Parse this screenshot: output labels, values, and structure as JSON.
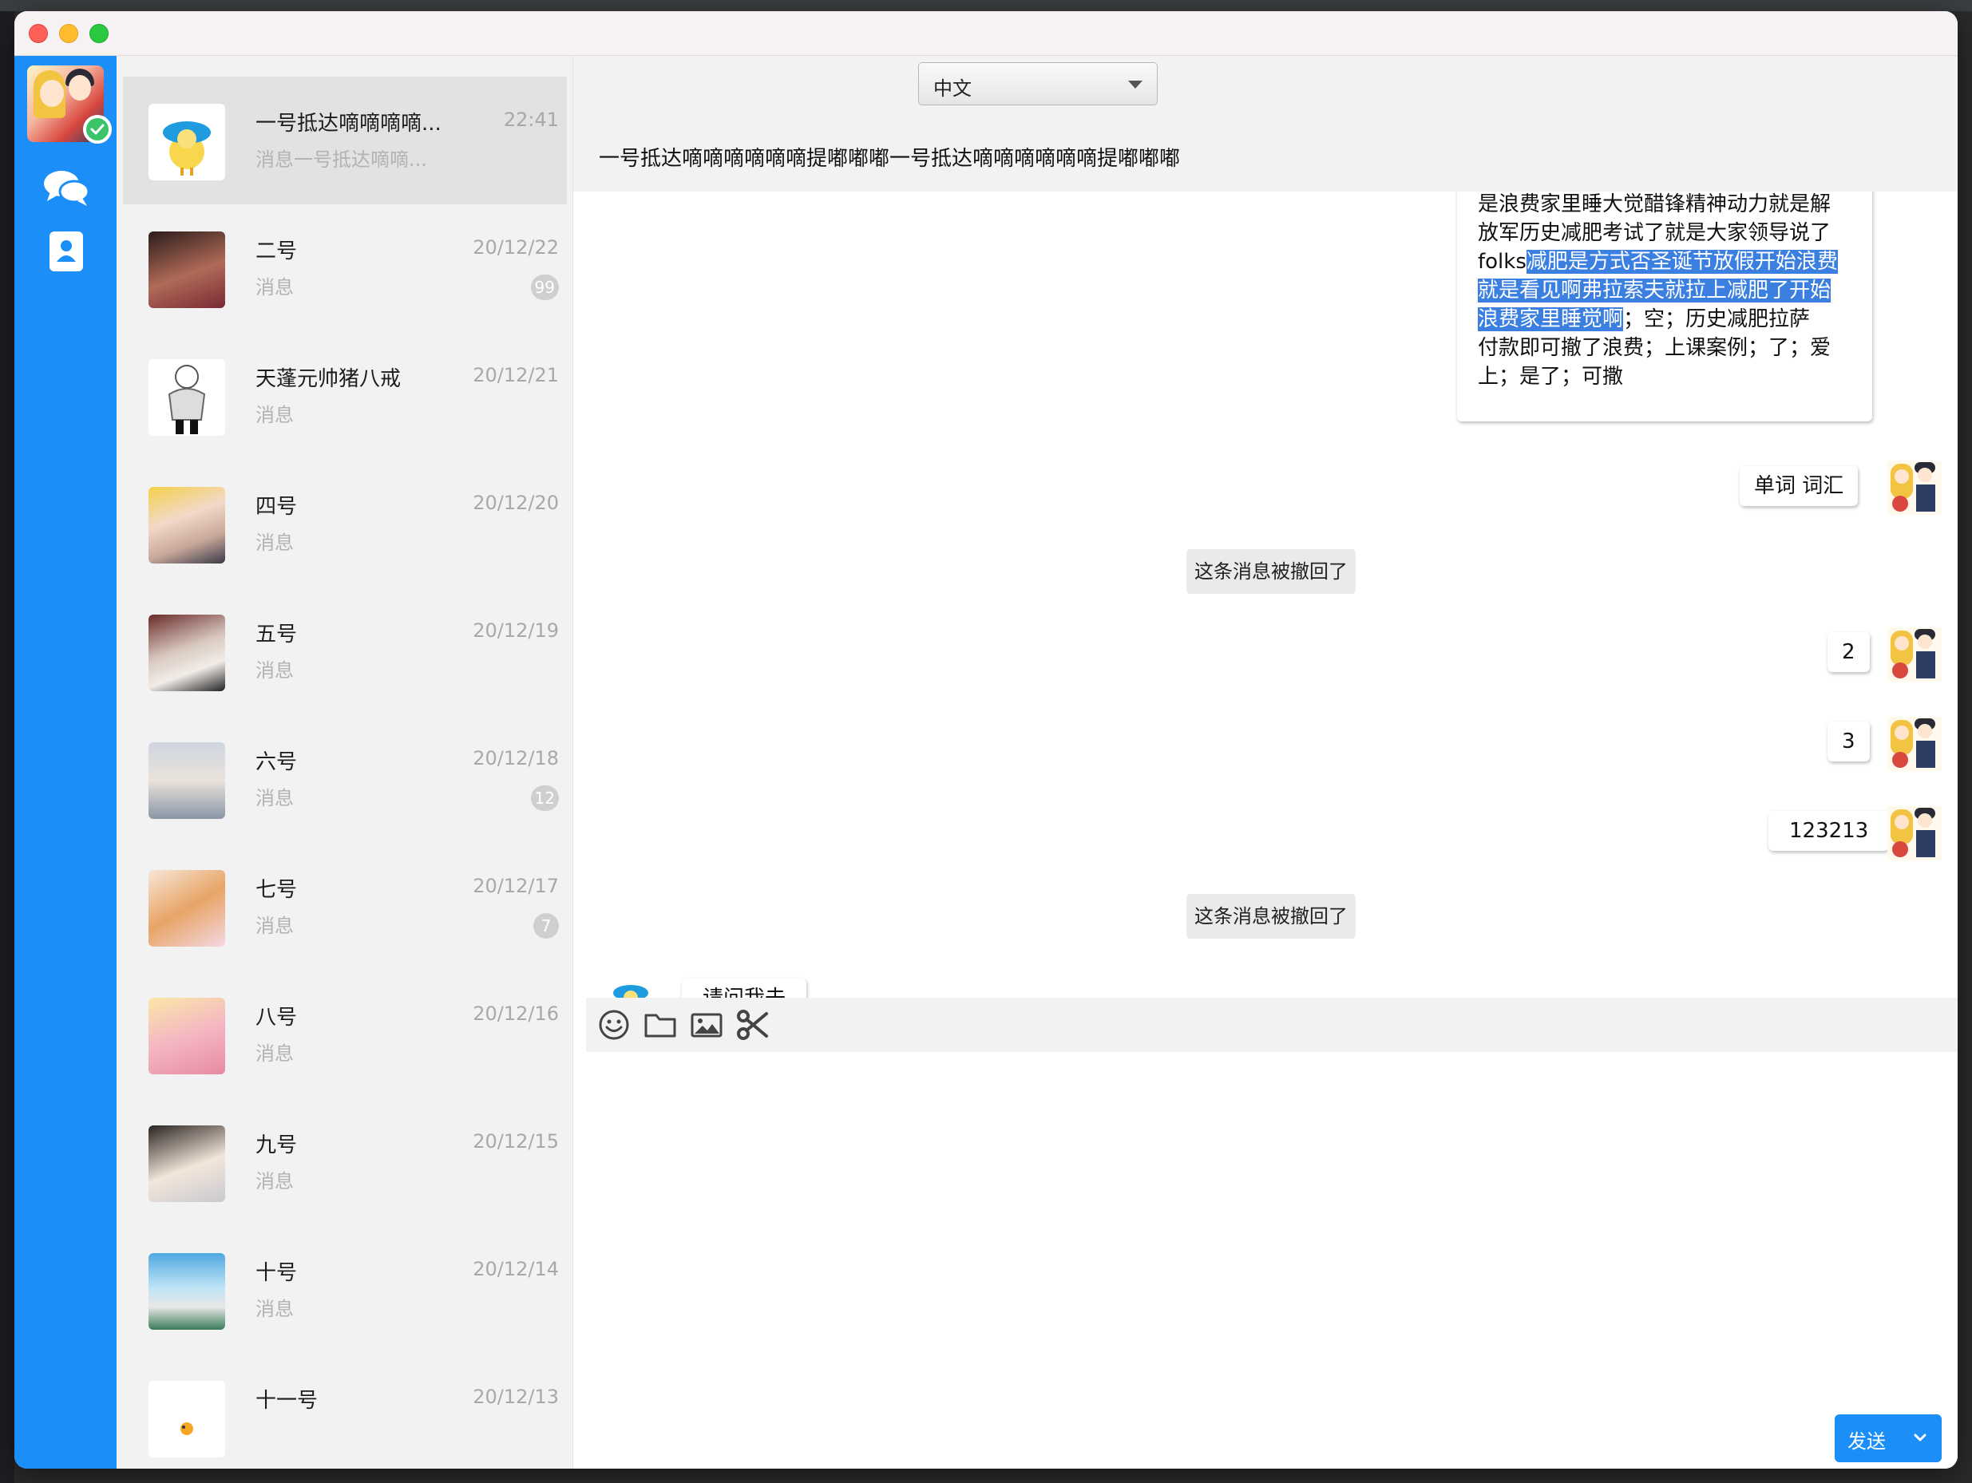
{
  "colors": {
    "accent": "#1b8ef8",
    "highlight": "#3b7fe0",
    "online": "#39c46a"
  },
  "nav": {
    "items": [
      {
        "icon": "chat-bubbles-icon"
      },
      {
        "icon": "contacts-icon"
      }
    ]
  },
  "language": {
    "selected": "中文"
  },
  "conversations": [
    {
      "name": "一号抵达嘀嘀嘀嘀...",
      "message": "消息一号抵达嘀嘀...",
      "time": "22:41",
      "badge": ""
    },
    {
      "name": "二号",
      "message": "消息",
      "time": "20/12/22",
      "badge": "99"
    },
    {
      "name": "天蓬元帅猪八戒",
      "message": "消息",
      "time": "20/12/21",
      "badge": ""
    },
    {
      "name": "四号",
      "message": "消息",
      "time": "20/12/20",
      "badge": ""
    },
    {
      "name": "五号",
      "message": "消息",
      "time": "20/12/19",
      "badge": ""
    },
    {
      "name": "六号",
      "message": "消息",
      "time": "20/12/18",
      "badge": "12"
    },
    {
      "name": "七号",
      "message": "消息",
      "time": "20/12/17",
      "badge": "7"
    },
    {
      "name": "八号",
      "message": "消息",
      "time": "20/12/16",
      "badge": ""
    },
    {
      "name": "九号",
      "message": "消息",
      "time": "20/12/15",
      "badge": ""
    },
    {
      "name": "十号",
      "message": "消息",
      "time": "20/12/14",
      "badge": ""
    },
    {
      "name": "十一号",
      "message": "消息",
      "time": "20/12/13",
      "badge": ""
    }
  ],
  "chat": {
    "title": "一号抵达嘀嘀嘀嘀嘀嘀提嘟嘟嘟一号抵达嘀嘀嘀嘀嘀嘀提嘟嘟嘟",
    "long_message": {
      "line0": "是浪费家里睡大觉醋锋精神动力就是解",
      "line1": "放军历史减肥考试了就是大家领导说了",
      "line2_plain": "folks",
      "line2_hl": "减肥是方式否圣诞节放假开始浪费",
      "line3_hl": "就是看见啊弗拉索夫就拉上减肥了开始",
      "line4_hl": "浪费家里睡觉啊",
      "line4_plain": "；空；历史减肥拉萨",
      "line5": "付款即可撤了浪费；上课案例；了；爱",
      "line6": "上；是了；可撒"
    },
    "msg_words": "单词 词汇",
    "recalled_1": "这条消息被撤回了",
    "msg_2": "2",
    "msg_3": "3",
    "msg_123213": "123213",
    "recalled_2": "这条消息被撤回了",
    "msg_incoming": "请问我去"
  },
  "toolbar": {
    "icons": [
      "emoji-icon",
      "folder-icon",
      "image-icon",
      "scissors-icon"
    ]
  },
  "send": {
    "label": "发送"
  }
}
